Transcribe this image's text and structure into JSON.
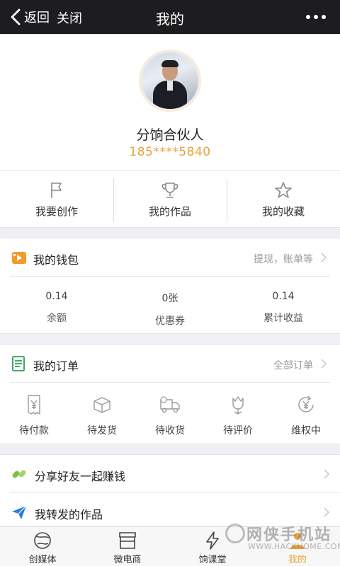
{
  "nav": {
    "back_label": "返回",
    "close_label": "关闭",
    "title": "我的",
    "more_icon": "more-dots-icon"
  },
  "profile": {
    "name": "分饷合伙人",
    "phone": "185****5840"
  },
  "actions": [
    {
      "label": "我要创作",
      "icon": "flag-icon"
    },
    {
      "label": "我的作品",
      "icon": "trophy-icon"
    },
    {
      "label": "我的收藏",
      "icon": "star-icon"
    }
  ],
  "wallet": {
    "title": "我的钱包",
    "link": "提现，账单等",
    "stats": [
      {
        "value": "0.14",
        "label": "余额"
      },
      {
        "value": "0张",
        "label": "优惠券"
      },
      {
        "value": "0.14",
        "label": "累计收益"
      }
    ]
  },
  "orders": {
    "title": "我的订单",
    "link": "全部订单",
    "items": [
      {
        "label": "待付款",
        "icon": "receipt-yen-icon"
      },
      {
        "label": "待发货",
        "icon": "box-icon"
      },
      {
        "label": "待收货",
        "icon": "truck-icon"
      },
      {
        "label": "待评价",
        "icon": "tulip-icon"
      },
      {
        "label": "维权中",
        "icon": "yen-refresh-icon"
      }
    ]
  },
  "list": [
    {
      "label": "分享好友一起赚钱",
      "icon": "chain-link-icon"
    },
    {
      "label": "我转发的作品",
      "icon": "paper-plane-icon"
    }
  ],
  "tabs": [
    {
      "label": "创媒体",
      "icon": "globe-icon"
    },
    {
      "label": "微电商",
      "icon": "store-icon"
    },
    {
      "label": "饷课堂",
      "icon": "lightning-icon"
    },
    {
      "label": "我的",
      "icon": "person-icon"
    }
  ],
  "watermark": {
    "main": "网侠手机站",
    "url": "WWW.HACKHOME.COM"
  },
  "colors": {
    "accent": "#e8a33a",
    "topbar": "#1d1d1f",
    "wallet_icon": "#f39a2b",
    "order_icon": "#27a154",
    "share_icon": "#7bc043",
    "plane_icon": "#2a7fe0"
  }
}
